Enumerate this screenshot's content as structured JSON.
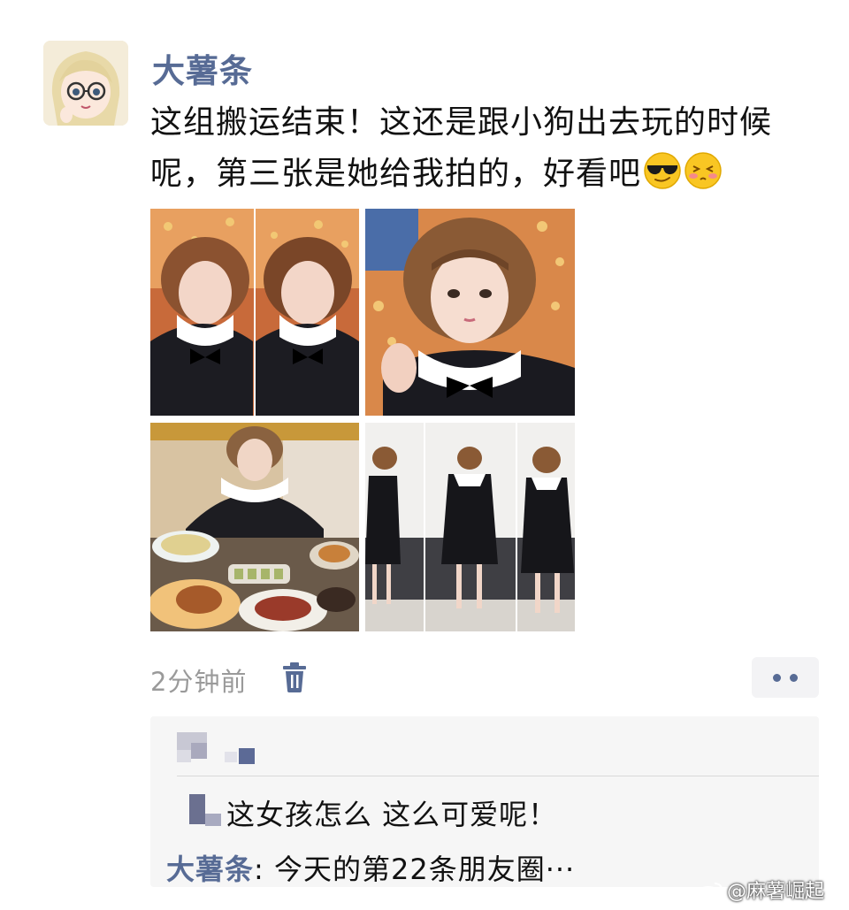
{
  "post": {
    "author": "大薯条",
    "text": "这组搬运结束！这还是跟小狗出去玩的时候呢，第三张是她给我拍的，好看吧",
    "emojis": [
      "cool-sunglasses-emoji",
      "blushing-face-emoji"
    ],
    "images": [
      {
        "name": "selfie-collage"
      },
      {
        "name": "selfie-closeup"
      },
      {
        "name": "restaurant-photo"
      },
      {
        "name": "mirror-selfie-collage"
      }
    ]
  },
  "footer": {
    "time": "2分钟前",
    "delete_icon": "trash-icon",
    "more_icon": "more-dots-icon"
  },
  "comments": [
    {
      "name": "",
      "text": "这女孩怎么 这么可爱呢！",
      "blurred_name": true
    },
    {
      "name": "大薯条",
      "sep": ":",
      "text": " 今天的第22条朋友圈···"
    }
  ],
  "watermark": {
    "icon": "weibo-logo-icon",
    "text": "@麻薯崛起"
  },
  "colors": {
    "link": "#576b95",
    "time": "#9a9a9a",
    "comment_bg": "#f6f6f6"
  }
}
